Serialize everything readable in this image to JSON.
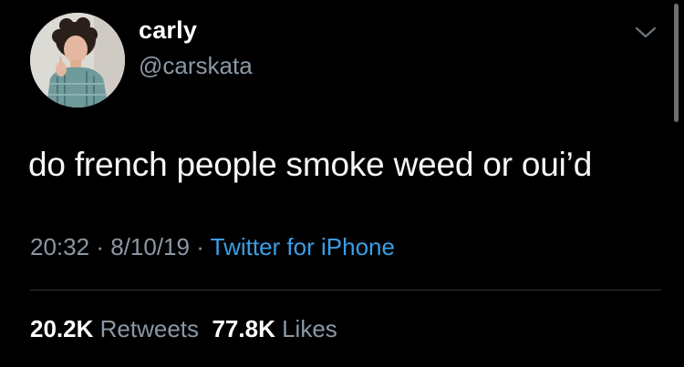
{
  "user": {
    "display_name": "carly",
    "handle": "@carskata",
    "avatar_icon": "profile-photo"
  },
  "tweet": {
    "text": "do french people smoke weed or oui’d",
    "time": "20:32",
    "date": "8/10/19",
    "separator": "·",
    "source": "Twitter for iPhone"
  },
  "stats": {
    "retweets_count": "20.2K",
    "retweets_label": "Retweets",
    "likes_count": "77.8K",
    "likes_label": "Likes"
  },
  "colors": {
    "background": "#000000",
    "primary_text": "#ffffff",
    "secondary_text": "#8b98a5",
    "link": "#3a9fe8",
    "divider": "#2f3336"
  },
  "icons": {
    "menu": "chevron-down-icon"
  }
}
